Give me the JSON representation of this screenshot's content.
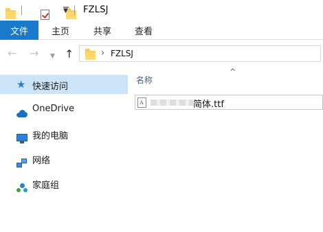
{
  "window": {
    "title": "FZLSJ"
  },
  "ribbon": {
    "tabs": [
      "文件",
      "主页",
      "共享",
      "查看"
    ]
  },
  "nav": {
    "back": "←",
    "forward": "→",
    "up": "↑",
    "path_separator": "›",
    "path": "FZLSJ"
  },
  "sidebar": {
    "items": [
      {
        "label": "快速访问",
        "icon": "star-icon",
        "selected": true
      },
      {
        "label": "OneDrive",
        "icon": "cloud-icon"
      },
      {
        "label": "我的电脑",
        "icon": "computer-icon"
      },
      {
        "label": "网络",
        "icon": "network-icon"
      },
      {
        "label": "家庭组",
        "icon": "homegroup-icon"
      }
    ]
  },
  "content": {
    "sort_indicator": "^",
    "column_header": "名称",
    "files": [
      {
        "name": "简体.ttf",
        "icon": "font-file-icon"
      }
    ]
  },
  "colors": {
    "file_tab": "#1979ca",
    "selected_item": "#cce4f7",
    "folder": "#ffd96b"
  }
}
